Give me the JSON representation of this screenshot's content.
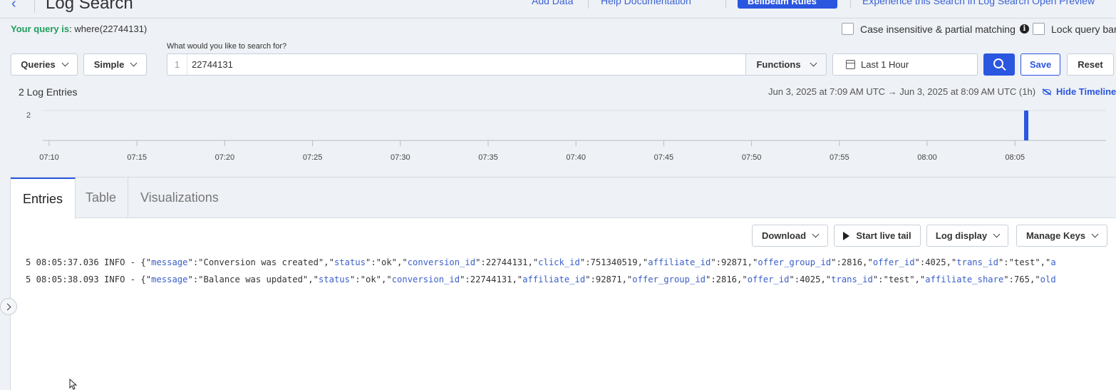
{
  "header": {
    "title": "Log Search",
    "add_data": "Add Data",
    "help_docs": "Help Documentation",
    "primary_button": "Bellbeam Rules",
    "experience_link": "Experience this Search in Log Search Open Preview"
  },
  "query": {
    "label": "Your query is",
    "value": ": where(22744131)"
  },
  "options": {
    "case_insensitive": "Case insensitive & partial matching",
    "lock_query_bar": "Lock query bar"
  },
  "toolbar": {
    "queries": "Queries",
    "mode": "Simple",
    "search_label": "What would you like to search for?",
    "line_number": "1",
    "search_value": "22744131",
    "functions": "Functions",
    "time_range": "Last 1 Hour",
    "save": "Save",
    "reset": "Reset"
  },
  "summary": {
    "entries": "2 Log Entries",
    "range": "Jun 3, 2025 at 7:09 AM UTC → Jun 3, 2025 at 8:09 AM UTC (1h)",
    "hide_timeline": "Hide Timeline"
  },
  "timeline": {
    "y_max_label": "2",
    "ticks": [
      "07:10",
      "07:15",
      "07:20",
      "07:25",
      "07:30",
      "07:35",
      "07:40",
      "07:45",
      "07:50",
      "07:55",
      "08:00",
      "08:05"
    ],
    "bar_time": "08:05:37",
    "bar_count": 2,
    "bar_color": "#2a56e0"
  },
  "tabs": [
    "Entries",
    "Table",
    "Visualizations"
  ],
  "actions": {
    "download": "Download",
    "live_tail": "Start live tail",
    "log_display": "Log display",
    "manage_keys": "Manage Keys"
  },
  "logs": [
    {
      "prefix": "5 08:05:37.036 INFO - {",
      "pairs": [
        [
          "message",
          "\"Conversion was created\""
        ],
        [
          "status",
          "\"ok\""
        ],
        [
          "conversion_id",
          "22744131"
        ],
        [
          "click_id",
          "751340519"
        ],
        [
          "affiliate_id",
          "92871"
        ],
        [
          "offer_group_id",
          "2816"
        ],
        [
          "offer_id",
          "4025"
        ],
        [
          "trans_id",
          "\"test\""
        ],
        [
          "a",
          ""
        ]
      ]
    },
    {
      "prefix": "5 08:05:38.093 INFO - {",
      "pairs": [
        [
          "message",
          "\"Balance was updated\""
        ],
        [
          "status",
          "\"ok\""
        ],
        [
          "conversion_id",
          "22744131"
        ],
        [
          "affiliate_id",
          "92871"
        ],
        [
          "offer_group_id",
          "2816"
        ],
        [
          "offer_id",
          "4025"
        ],
        [
          "trans_id",
          "\"test\""
        ],
        [
          "affiliate_share",
          "765"
        ],
        [
          "old",
          ""
        ]
      ]
    }
  ]
}
